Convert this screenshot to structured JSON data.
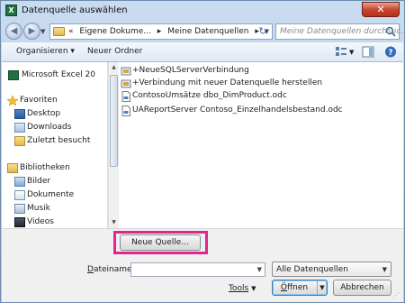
{
  "window": {
    "title": "Datenquelle auswählen",
    "app_icon_letter": "X",
    "close_glyph": "✕"
  },
  "address": {
    "crumbs": [
      "«",
      "Eigene Dokume...",
      "▸",
      "Meine Datenquellen",
      "▸"
    ],
    "search_placeholder": "Meine Datenquellen durchsuc..."
  },
  "toolbar": {
    "organize": "Organisieren ▾",
    "new_folder": "Neuer Ordner"
  },
  "nav": {
    "excel": "Microsoft Excel 20",
    "favorites": "Favoriten",
    "desktop": "Desktop",
    "downloads": "Downloads",
    "recent": "Zuletzt besucht",
    "libraries": "Bibliotheken",
    "pictures": "Bilder",
    "documents": "Dokumente",
    "music": "Musik",
    "videos": "Videos"
  },
  "files": [
    "+NeueSQLServerVerbindung",
    "+Verbindung mit neuer Datenquelle herstellen",
    "ContosoUmsätze dbo_DimProduct.odc",
    "UAReportServer Contoso_Einzelhandelsbestand.odc"
  ],
  "bottom": {
    "new_source": "Neue Quelle...",
    "filename_label_u": "D",
    "filename_label_rest": "ateiname:",
    "filename_value": "",
    "filter_value": "Alle Datenquellen",
    "tools_label": "Tools",
    "open_u": "Ö",
    "open_rest": "ffnen",
    "cancel": "Abbrechen"
  },
  "colors": {
    "highlight": "#e0268f",
    "excel_green": "#1f7244"
  },
  "icons": {
    "back": "arrow-left-icon",
    "forward": "arrow-right-icon",
    "refresh": "refresh-icon",
    "search": "search-icon"
  }
}
